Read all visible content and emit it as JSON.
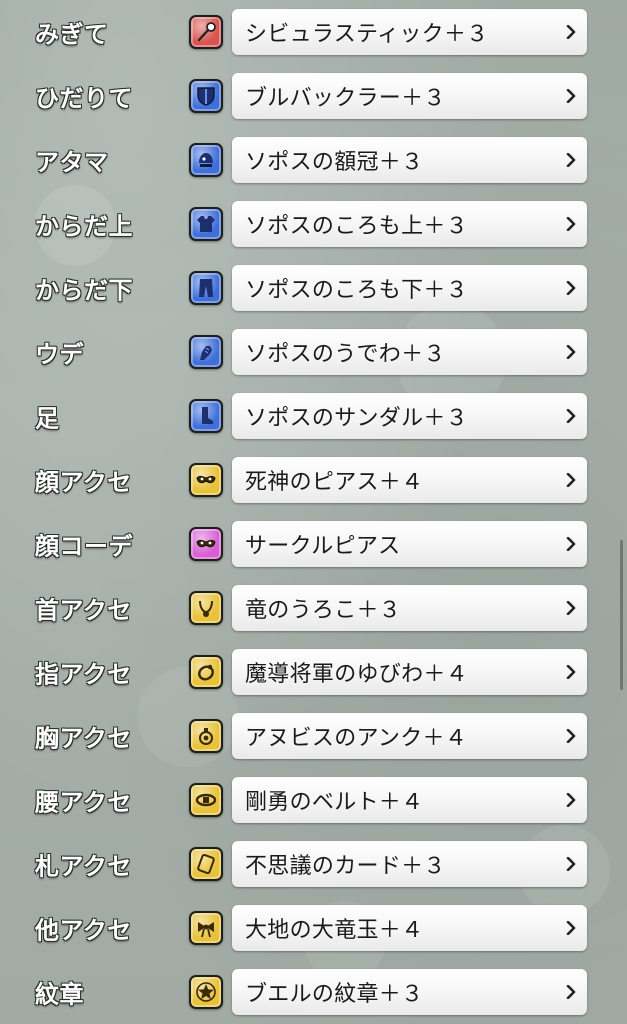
{
  "equipment": [
    {
      "slot": "みぎて",
      "item": "シビュラスティック＋３",
      "icon": "staff-icon",
      "icon_color": "red"
    },
    {
      "slot": "ひだりて",
      "item": "ブルバックラー＋３",
      "icon": "shield-icon",
      "icon_color": "blue"
    },
    {
      "slot": "アタマ",
      "item": "ソポスの額冠＋３",
      "icon": "helmet-icon",
      "icon_color": "blue"
    },
    {
      "slot": "からだ上",
      "item": "ソポスのころも上＋３",
      "icon": "shirt-icon",
      "icon_color": "blue"
    },
    {
      "slot": "からだ下",
      "item": "ソポスのころも下＋３",
      "icon": "pants-icon",
      "icon_color": "blue"
    },
    {
      "slot": "ウデ",
      "item": "ソポスのうでわ＋３",
      "icon": "gauntlet-icon",
      "icon_color": "blue"
    },
    {
      "slot": "足",
      "item": "ソポスのサンダル＋３",
      "icon": "boots-icon",
      "icon_color": "blue"
    },
    {
      "slot": "顔アクセ",
      "item": "死神のピアス＋４",
      "icon": "mask-icon",
      "icon_color": "gold"
    },
    {
      "slot": "顔コーデ",
      "item": "サークルピアス",
      "icon": "mask-icon",
      "icon_color": "pink"
    },
    {
      "slot": "首アクセ",
      "item": "竜のうろこ＋３",
      "icon": "necklace-icon",
      "icon_color": "gold"
    },
    {
      "slot": "指アクセ",
      "item": "魔導将軍のゆびわ＋４",
      "icon": "ring-icon",
      "icon_color": "gold"
    },
    {
      "slot": "胸アクセ",
      "item": "アヌビスのアンク＋４",
      "icon": "brooch-icon",
      "icon_color": "gold"
    },
    {
      "slot": "腰アクセ",
      "item": "剛勇のベルト＋４",
      "icon": "belt-icon",
      "icon_color": "gold"
    },
    {
      "slot": "札アクセ",
      "item": "不思議のカード＋３",
      "icon": "card-icon",
      "icon_color": "gold"
    },
    {
      "slot": "他アクセ",
      "item": "大地の大竜玉＋４",
      "icon": "ribbon-icon",
      "icon_color": "gold"
    },
    {
      "slot": "紋章",
      "item": "ブエルの紋章＋３",
      "icon": "emblem-icon",
      "icon_color": "gold"
    }
  ],
  "colors": {
    "red": "#d9534f",
    "blue": "#3f6fd8",
    "gold": "#e8c23a",
    "pink": "#d85fd3",
    "chevron": "#222222"
  }
}
